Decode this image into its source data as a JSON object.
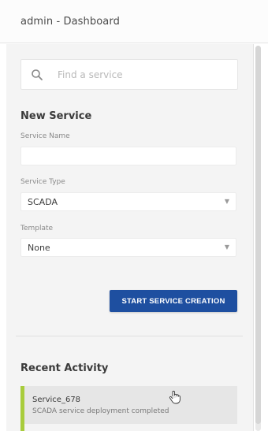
{
  "header": {
    "title": "admin - Dashboard"
  },
  "search": {
    "placeholder": "Find a service",
    "icon": "search-icon"
  },
  "new_service": {
    "title": "New Service",
    "service_name": {
      "label": "Service Name",
      "value": ""
    },
    "service_type": {
      "label": "Service Type",
      "value": "SCADA"
    },
    "template": {
      "label": "Template",
      "value": "None"
    },
    "submit_label": "START SERVICE CREATION"
  },
  "recent_activity": {
    "title": "Recent Activity",
    "items": [
      {
        "title": "Service_678",
        "description": "SCADA service deployment completed"
      }
    ]
  },
  "colors": {
    "primary": "#1e4fa0",
    "accent": "#a8cc3c",
    "panel_bg": "#f4f4f4"
  }
}
